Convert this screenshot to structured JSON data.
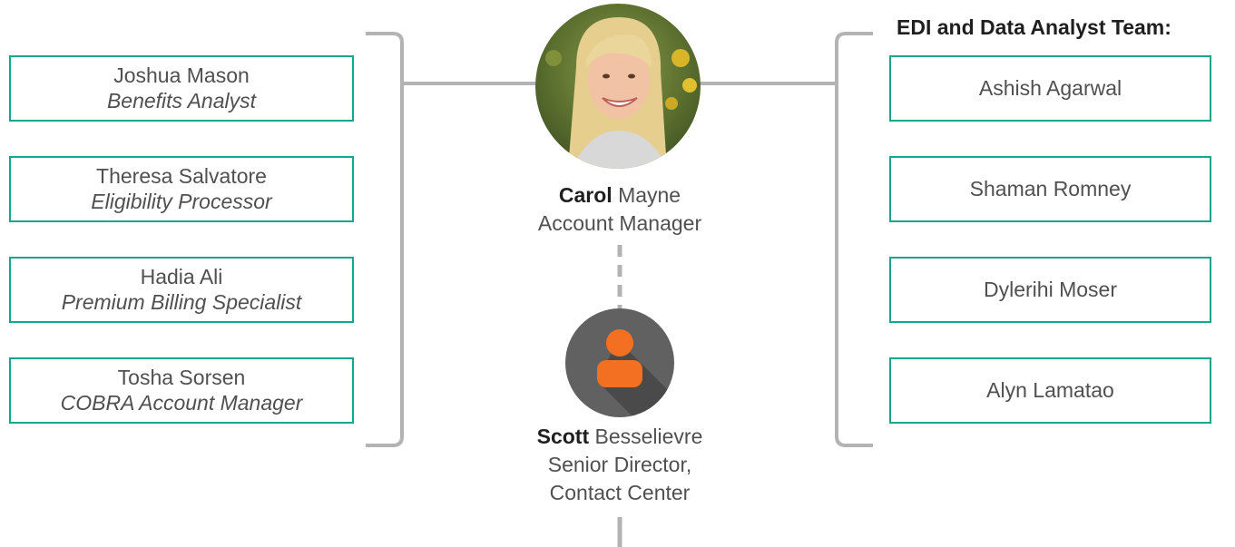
{
  "left_team": [
    {
      "name": "Joshua Mason",
      "role": "Benefits Analyst"
    },
    {
      "name": "Theresa Salvatore",
      "role": "Eligibility Processor"
    },
    {
      "name": "Hadia Ali",
      "role": "Premium Billing Specialist"
    },
    {
      "name": "Tosha Sorsen",
      "role": "COBRA Account Manager"
    }
  ],
  "manager": {
    "first_name": "Carol",
    "last_name": "Mayne",
    "title": "Account Manager"
  },
  "director": {
    "first_name": "Scott",
    "last_name": "Besselievre",
    "title_line1": "Senior Director,",
    "title_line2": "Contact Center"
  },
  "right_team": {
    "title": "EDI and Data Analyst Team:",
    "members": [
      {
        "name": "Ashish Agarwal"
      },
      {
        "name": "Shaman Romney"
      },
      {
        "name": "Dylerihi Moser"
      },
      {
        "name": "Alyn Lamatao"
      }
    ]
  },
  "colors": {
    "box_border": "#1aa58d",
    "connector": "#b3b3b3",
    "avatar_bg": "#616161",
    "avatar_figure": "#f36f21"
  }
}
